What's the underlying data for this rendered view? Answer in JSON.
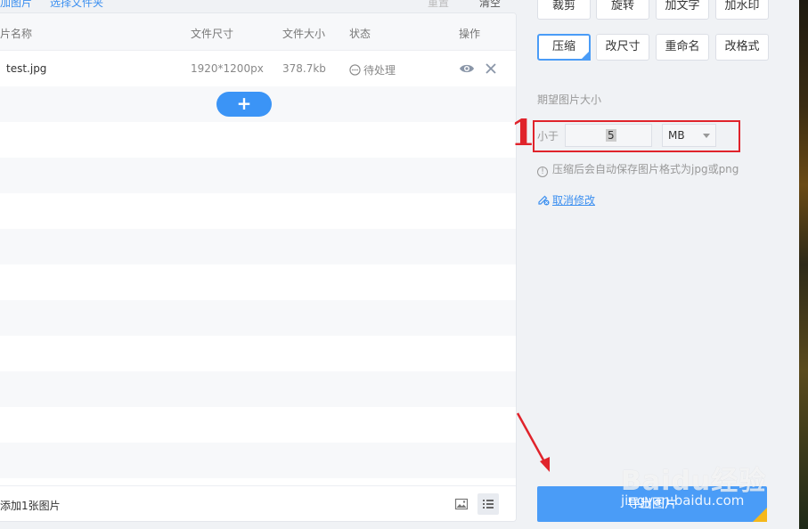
{
  "toolbar": {
    "add_image": "加图片",
    "add_folder": "选择文件夹",
    "reset": "重置",
    "clear": "清空"
  },
  "table": {
    "columns": [
      "片名称",
      "文件尺寸",
      "文件大小",
      "状态",
      "操作"
    ],
    "rows": [
      {
        "name": "test.jpg",
        "dimensions": "1920*1200px",
        "size": "378.7kb",
        "status": "待处理"
      }
    ],
    "add_button": "+"
  },
  "footer": {
    "count_text": "添加1张图片"
  },
  "tools": {
    "row1": [
      "裁剪",
      "旋转",
      "加文字",
      "加水印"
    ],
    "row2": [
      "压缩",
      "改尺寸",
      "重命名",
      "改格式"
    ],
    "active": "压缩"
  },
  "compress": {
    "section_label": "期望图片大小",
    "less_than": "小于",
    "value": "5",
    "unit": "MB",
    "hint": "压缩后会自动保存图片格式为jpg或png",
    "cancel": "取消修改"
  },
  "export_button": "导出图片",
  "annotation": {
    "step": "1"
  },
  "watermark": {
    "logo": "Baidu经验",
    "url": "jingyan.baidu.com"
  },
  "colors": {
    "accent": "#4a9cf7",
    "highlight_box": "#e0232b",
    "vip_corner": "#f5b81c"
  }
}
